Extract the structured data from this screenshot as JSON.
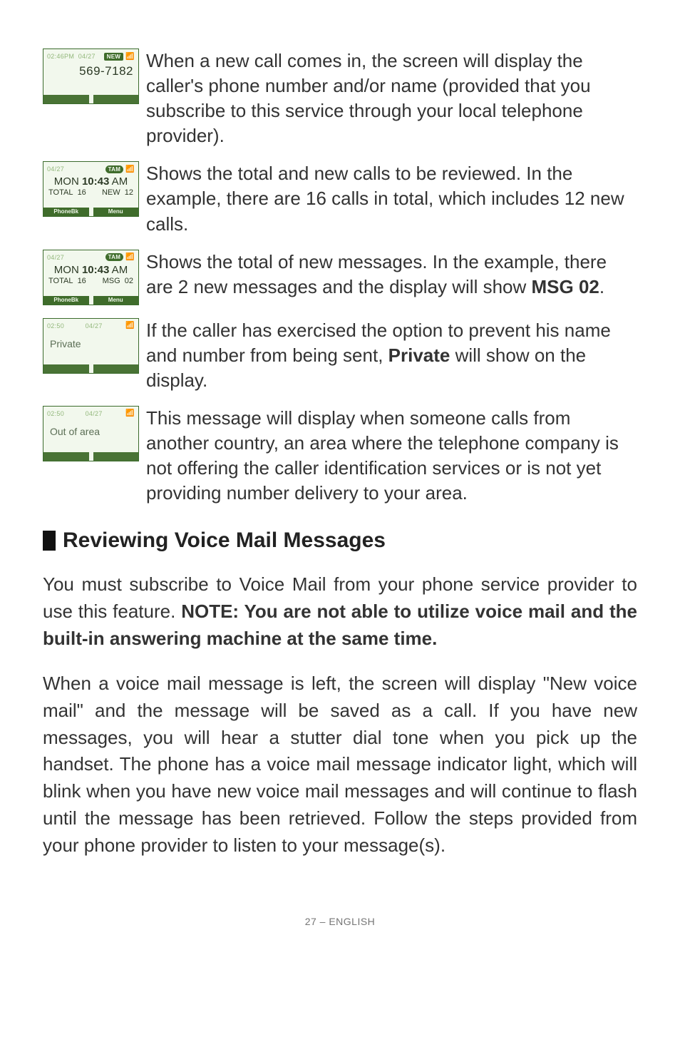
{
  "lcds": {
    "row1": {
      "time": "02:46PM",
      "date": "04/27",
      "new_badge": "NEW",
      "number": "569-7182"
    },
    "row2": {
      "date": "04/27",
      "tam_badge": "TAM",
      "main_pre": "MON ",
      "main_bold": "10:43",
      "main_post": " AM",
      "totalLabel": "TOTAL",
      "totalVal": "16",
      "rightLabel": "NEW",
      "rightVal": "12",
      "skLeft": "PhoneBk",
      "skRight": "Menu"
    },
    "row3": {
      "date": "04/27",
      "tam_badge": "TAM",
      "main_pre": "MON ",
      "main_bold": "10:43",
      "main_post": " AM",
      "totalLabel": "TOTAL",
      "totalVal": "16",
      "rightLabel": "MSG",
      "rightVal": "02",
      "skLeft": "PhoneBk",
      "skRight": "Menu"
    },
    "row4": {
      "time": "02:50",
      "date": "04/27",
      "text": "Private"
    },
    "row5": {
      "time": "02:50",
      "date": "04/27",
      "text": "Out of area"
    }
  },
  "paras": {
    "p1": "When a new call comes in, the screen will display the caller's phone number and/or name (provided that you subscribe to this service through your local telephone provider).",
    "p2": "Shows the total and new calls to be reviewed. In the example, there are 16 calls in total, which includes 12 new calls.",
    "p3_a": "Shows the total of new messages. In the example, there are 2 new messages and the display will show ",
    "p3_b": "MSG 02",
    "p3_c": ".",
    "p4_a": "If the caller has exercised the option to prevent his name and number from being sent, ",
    "p4_b": "Private",
    "p4_c": " will show on the display.",
    "p5": "This message will display when someone calls from another country, an area where the telephone company is not offering the caller identification services or is not yet providing number delivery to your area."
  },
  "heading": "Reviewing Voice Mail Messages",
  "body1_a": "You must subscribe to Voice Mail from your phone service provider to use this feature. ",
  "body1_b": "NOTE: You are not able to utilize voice mail and the built-in answering machine at the same time.",
  "body2": "When a voice mail message is left, the screen will display \"New voice mail\" and the message will be saved as a call. If you have new messages, you will hear a stutter dial tone when you pick up the handset.  The phone has a voice mail message indicator light, which will blink when you have new voice mail messages and will continue to flash until the message has been retrieved.  Follow the steps provided from your phone provider to listen to your message(s).",
  "footer": "27 – ENGLISH"
}
